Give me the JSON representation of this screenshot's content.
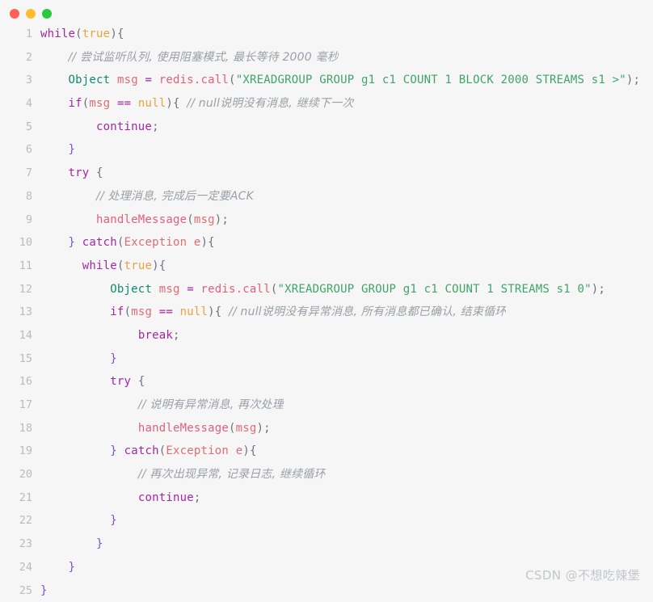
{
  "window": {
    "title_bar": {
      "buttons": [
        {
          "name": "close-button",
          "icon": "close-dot",
          "color": "#ff5f56"
        },
        {
          "name": "minimize-button",
          "icon": "minimize-dot",
          "color": "#ffbd2e"
        },
        {
          "name": "zoom-button",
          "icon": "zoom-dot",
          "color": "#27c93f"
        }
      ]
    }
  },
  "watermark": {
    "text": "CSDN @不想吃辣堡"
  },
  "editor": {
    "language": "java",
    "line_count": 25,
    "lines": [
      {
        "num": "1",
        "indent": 0,
        "tokens": [
          {
            "t": "keyword",
            "v": "while"
          },
          {
            "t": "punct",
            "v": "("
          },
          {
            "t": "literal",
            "v": "true"
          },
          {
            "t": "punct",
            "v": "){"
          }
        ]
      },
      {
        "num": "2",
        "indent": 2,
        "tokens": [
          {
            "t": "comment",
            "v": "// 尝试监听队列, 使用阻塞模式, 最长等待 2000 毫秒"
          }
        ]
      },
      {
        "num": "3",
        "indent": 2,
        "tokens": [
          {
            "t": "type",
            "v": "Object"
          },
          {
            "t": "plain",
            "v": " "
          },
          {
            "t": "var",
            "v": "msg"
          },
          {
            "t": "plain",
            "v": " "
          },
          {
            "t": "keyword",
            "v": "="
          },
          {
            "t": "plain",
            "v": " "
          },
          {
            "t": "func",
            "v": "redis.call"
          },
          {
            "t": "punct",
            "v": "("
          },
          {
            "t": "string",
            "v": "\"XREADGROUP GROUP g1 c1 COUNT 1 BLOCK 2000 STREAMS s1 >\""
          },
          {
            "t": "punct",
            "v": ");"
          }
        ]
      },
      {
        "num": "4",
        "indent": 2,
        "tokens": [
          {
            "t": "keyword",
            "v": "if"
          },
          {
            "t": "punct",
            "v": "("
          },
          {
            "t": "var",
            "v": "msg"
          },
          {
            "t": "plain",
            "v": " "
          },
          {
            "t": "keyword",
            "v": "=="
          },
          {
            "t": "plain",
            "v": " "
          },
          {
            "t": "literal",
            "v": "null"
          },
          {
            "t": "punct",
            "v": "){"
          },
          {
            "t": "plain",
            "v": " "
          },
          {
            "t": "comment",
            "v": "// null说明没有消息, 继续下一次"
          }
        ]
      },
      {
        "num": "5",
        "indent": 4,
        "tokens": [
          {
            "t": "keyword",
            "v": "continue"
          },
          {
            "t": "punct",
            "v": ";"
          }
        ]
      },
      {
        "num": "6",
        "indent": 2,
        "tokens": [
          {
            "t": "brace",
            "v": "}"
          }
        ]
      },
      {
        "num": "7",
        "indent": 2,
        "tokens": [
          {
            "t": "keyword",
            "v": "try"
          },
          {
            "t": "plain",
            "v": " "
          },
          {
            "t": "punct",
            "v": "{"
          }
        ]
      },
      {
        "num": "8",
        "indent": 4,
        "tokens": [
          {
            "t": "comment",
            "v": "// 处理消息, 完成后一定要ACK"
          }
        ]
      },
      {
        "num": "9",
        "indent": 4,
        "tokens": [
          {
            "t": "func",
            "v": "handleMessage"
          },
          {
            "t": "punct",
            "v": "("
          },
          {
            "t": "var",
            "v": "msg"
          },
          {
            "t": "punct",
            "v": ");"
          }
        ]
      },
      {
        "num": "10",
        "indent": 2,
        "tokens": [
          {
            "t": "brace",
            "v": "}"
          },
          {
            "t": "plain",
            "v": " "
          },
          {
            "t": "keyword",
            "v": "catch"
          },
          {
            "t": "punct",
            "v": "("
          },
          {
            "t": "class",
            "v": "Exception"
          },
          {
            "t": "plain",
            "v": " "
          },
          {
            "t": "var",
            "v": "e"
          },
          {
            "t": "punct",
            "v": "){"
          }
        ]
      },
      {
        "num": "11",
        "indent": 3,
        "tokens": [
          {
            "t": "keyword",
            "v": "while"
          },
          {
            "t": "punct",
            "v": "("
          },
          {
            "t": "literal",
            "v": "true"
          },
          {
            "t": "punct",
            "v": "){"
          }
        ]
      },
      {
        "num": "12",
        "indent": 5,
        "tokens": [
          {
            "t": "type",
            "v": "Object"
          },
          {
            "t": "plain",
            "v": " "
          },
          {
            "t": "var",
            "v": "msg"
          },
          {
            "t": "plain",
            "v": " "
          },
          {
            "t": "keyword",
            "v": "="
          },
          {
            "t": "plain",
            "v": " "
          },
          {
            "t": "func",
            "v": "redis.call"
          },
          {
            "t": "punct",
            "v": "("
          },
          {
            "t": "string",
            "v": "\"XREADGROUP GROUP g1 c1 COUNT 1 STREAMS s1 0\""
          },
          {
            "t": "punct",
            "v": ");"
          }
        ]
      },
      {
        "num": "13",
        "indent": 5,
        "tokens": [
          {
            "t": "keyword",
            "v": "if"
          },
          {
            "t": "punct",
            "v": "("
          },
          {
            "t": "var",
            "v": "msg"
          },
          {
            "t": "plain",
            "v": " "
          },
          {
            "t": "keyword",
            "v": "=="
          },
          {
            "t": "plain",
            "v": " "
          },
          {
            "t": "literal",
            "v": "null"
          },
          {
            "t": "punct",
            "v": "){"
          },
          {
            "t": "plain",
            "v": " "
          },
          {
            "t": "comment",
            "v": "// null说明没有异常消息, 所有消息都已确认, 结束循环"
          }
        ]
      },
      {
        "num": "14",
        "indent": 7,
        "tokens": [
          {
            "t": "keyword",
            "v": "break"
          },
          {
            "t": "punct",
            "v": ";"
          }
        ]
      },
      {
        "num": "15",
        "indent": 5,
        "tokens": [
          {
            "t": "brace",
            "v": "}"
          }
        ]
      },
      {
        "num": "16",
        "indent": 5,
        "tokens": [
          {
            "t": "keyword",
            "v": "try"
          },
          {
            "t": "plain",
            "v": " "
          },
          {
            "t": "punct",
            "v": "{"
          }
        ]
      },
      {
        "num": "17",
        "indent": 7,
        "tokens": [
          {
            "t": "comment",
            "v": "// 说明有异常消息, 再次处理"
          }
        ]
      },
      {
        "num": "18",
        "indent": 7,
        "tokens": [
          {
            "t": "func",
            "v": "handleMessage"
          },
          {
            "t": "punct",
            "v": "("
          },
          {
            "t": "var",
            "v": "msg"
          },
          {
            "t": "punct",
            "v": ");"
          }
        ]
      },
      {
        "num": "19",
        "indent": 5,
        "tokens": [
          {
            "t": "brace",
            "v": "}"
          },
          {
            "t": "plain",
            "v": " "
          },
          {
            "t": "keyword",
            "v": "catch"
          },
          {
            "t": "punct",
            "v": "("
          },
          {
            "t": "class",
            "v": "Exception"
          },
          {
            "t": "plain",
            "v": " "
          },
          {
            "t": "var",
            "v": "e"
          },
          {
            "t": "punct",
            "v": "){"
          }
        ]
      },
      {
        "num": "20",
        "indent": 7,
        "tokens": [
          {
            "t": "comment",
            "v": "// 再次出现异常, 记录日志, 继续循环"
          }
        ]
      },
      {
        "num": "21",
        "indent": 7,
        "tokens": [
          {
            "t": "keyword",
            "v": "continue"
          },
          {
            "t": "punct",
            "v": ";"
          }
        ]
      },
      {
        "num": "22",
        "indent": 5,
        "tokens": [
          {
            "t": "brace",
            "v": "}"
          }
        ]
      },
      {
        "num": "23",
        "indent": 4,
        "tokens": [
          {
            "t": "brace",
            "v": "}"
          }
        ]
      },
      {
        "num": "24",
        "indent": 2,
        "tokens": [
          {
            "t": "brace",
            "v": "}"
          }
        ]
      },
      {
        "num": "25",
        "indent": 0,
        "tokens": [
          {
            "t": "brace",
            "v": "}"
          }
        ]
      }
    ]
  }
}
